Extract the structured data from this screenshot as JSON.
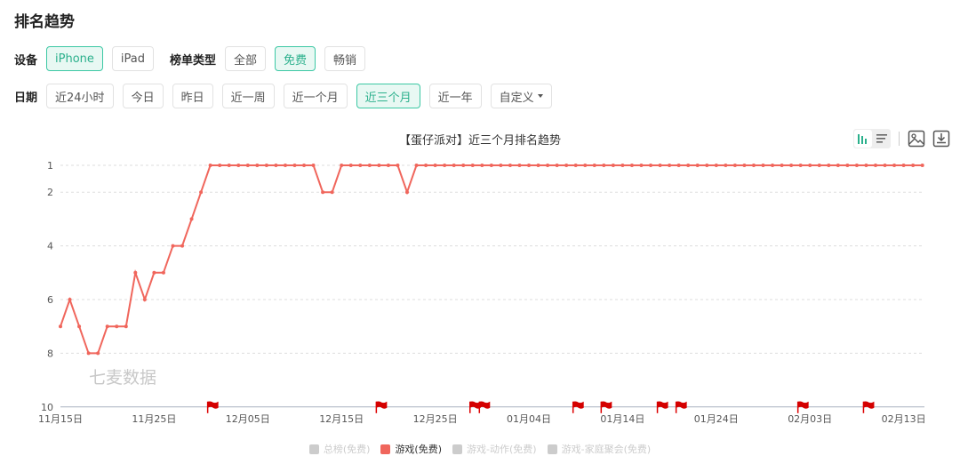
{
  "page_title": "排名趋势",
  "filters": {
    "device_label": "设备",
    "devices": [
      {
        "label": "iPhone",
        "active": true
      },
      {
        "label": "iPad",
        "active": false
      }
    ],
    "list_type_label": "榜单类型",
    "list_types": [
      {
        "label": "全部",
        "active": false
      },
      {
        "label": "免费",
        "active": true
      },
      {
        "label": "畅销",
        "active": false
      }
    ],
    "date_label": "日期",
    "dates": [
      {
        "label": "近24小时",
        "active": false
      },
      {
        "label": "今日",
        "active": false
      },
      {
        "label": "昨日",
        "active": false
      },
      {
        "label": "近一周",
        "active": false
      },
      {
        "label": "近一个月",
        "active": false
      },
      {
        "label": "近三个月",
        "active": true
      },
      {
        "label": "近一年",
        "active": false
      }
    ],
    "custom_label": "自定义"
  },
  "toolbar": {
    "icons": [
      "bar-chart-icon",
      "list-icon",
      "image-icon",
      "download-icon"
    ],
    "accent": "#2bb08c"
  },
  "watermark": "七麦数据",
  "chart_data": {
    "type": "line",
    "title": "【蛋仔派对】近三个月排名趋势",
    "xlabel": "",
    "ylabel": "",
    "y_inverted": true,
    "ylim": [
      1,
      10
    ],
    "y_ticks": [
      1,
      2,
      4,
      6,
      8,
      10
    ],
    "x_tick_labels": [
      "11月15日",
      "11月25日",
      "12月05日",
      "12月15日",
      "12月25日",
      "01月04日",
      "01月14日",
      "01月24日",
      "02月03日",
      "02月13日"
    ],
    "x_tick_interval_days": 10,
    "start_date": "11月15日",
    "grid": true,
    "series": [
      {
        "name": "游戏(免费)",
        "color": "#f0665c",
        "values": [
          7,
          6,
          7,
          8,
          8,
          7,
          7,
          7,
          5,
          6,
          5,
          5,
          4,
          4,
          3,
          2,
          1,
          1,
          1,
          1,
          1,
          1,
          1,
          1,
          1,
          1,
          1,
          1,
          2,
          2,
          1,
          1,
          1,
          1,
          1,
          1,
          1,
          2,
          1,
          1,
          1,
          1,
          1,
          1,
          1,
          1,
          1,
          1,
          1,
          1,
          1,
          1,
          1,
          1,
          1,
          1,
          1,
          1,
          1,
          1,
          1,
          1,
          1,
          1,
          1,
          1,
          1,
          1,
          1,
          1,
          1,
          1,
          1,
          1,
          1,
          1,
          1,
          1,
          1,
          1,
          1,
          1,
          1,
          1,
          1,
          1,
          1,
          1,
          1,
          1,
          1,
          1,
          1
        ]
      }
    ],
    "event_flags_day_index": [
      16,
      34,
      44,
      45,
      55,
      58,
      64,
      66,
      79,
      86
    ],
    "legend": [
      {
        "label": "总榜(免费)",
        "active": false,
        "color": "#cccccc"
      },
      {
        "label": "游戏(免费)",
        "active": true,
        "color": "#f0665c"
      },
      {
        "label": "游戏-动作(免费)",
        "active": false,
        "color": "#cccccc"
      },
      {
        "label": "游戏-家庭聚会(免费)",
        "active": false,
        "color": "#cccccc"
      }
    ],
    "legend_position": "bottom"
  }
}
